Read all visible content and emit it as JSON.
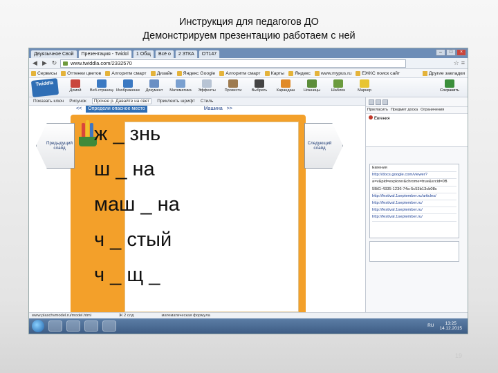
{
  "slide": {
    "title_line1": "Инструкция для педагогов ДО",
    "title_line2": "Демонстрируем презентацию работаем с ней",
    "page_number": "19"
  },
  "browser": {
    "tabs": [
      {
        "label": "Двуязычное Свой",
        "active": false
      },
      {
        "label": "Презентация - Twidol",
        "active": true
      },
      {
        "label": "1 Общ",
        "active": false
      },
      {
        "label": "Всё о",
        "active": false
      },
      {
        "label": "2 ЗТКА",
        "active": false
      },
      {
        "label": "ОТ147",
        "active": false
      }
    ],
    "url": "www.twiddla.com/2332570",
    "bookmarks": [
      "Сервисы",
      "Оттенки цветов",
      "Алгоритм смарт",
      "Дизайн",
      "Яндекс Google",
      "Алгоритм смарт",
      "Карты",
      "Яндекс",
      "www.mypus.ru",
      "ЕЖКС поиск сайт"
    ],
    "bookmarks_right": "Другие закладки"
  },
  "app": {
    "logo": "Twiddla",
    "tools": [
      {
        "label": "Домой",
        "color": "#c9463d"
      },
      {
        "label": "Веб-страница",
        "color": "#3b79c2"
      },
      {
        "label": "Изображение",
        "color": "#3b79c2"
      },
      {
        "label": "Документ",
        "color": "#6a8fc4"
      },
      {
        "label": "Математика",
        "color": "#7aa0d0"
      },
      {
        "label": "Эффекты",
        "color": "#b8c4d4"
      },
      {
        "label": "Провести",
        "color": "#9e7b4f"
      },
      {
        "label": "Выбрать",
        "color": "#444444"
      },
      {
        "label": "Карандаш",
        "color": "#e08a28"
      },
      {
        "label": "Ножницы",
        "color": "#5c8d3a"
      },
      {
        "label": "Шаблон",
        "color": "#6b9b3e"
      },
      {
        "label": "Маркер",
        "color": "#e8c532"
      }
    ],
    "save_label": "Сохранить",
    "subbar": [
      "Показать ключ",
      "Рисунок",
      "Приклеить шрифт",
      "Стиль"
    ],
    "subbar_field": "Прочее p. Давайте на свет",
    "slide_nav": {
      "prev": "<<",
      "current": "Определи опасное место",
      "next_item": "Машина",
      "next": ">>"
    },
    "prev_button": "Предыдущий слайд",
    "next_button": "Следующий слайд"
  },
  "slide_content": {
    "words": [
      "ж _ знь",
      "ш _ на",
      "маш _ на",
      "ч _ стый",
      "ч _ щ _"
    ]
  },
  "right_panel": {
    "head": [
      "Пригласить",
      "Предмет доска",
      "Ограничения"
    ],
    "participant": "Евгения",
    "chat_lines": [
      {
        "text": "Евгения",
        "link": false
      },
      {
        "text": "http://docs.google.com/viewer?",
        "link": true
      },
      {
        "text": "a=v&pid=explorer&chrome=true&srcid=0B",
        "link": false
      },
      {
        "text": "5BiG-4335-1236-74a-5c53b13cb08c",
        "link": false
      },
      {
        "text": "http://festival.1september.ru/articles/",
        "link": true
      },
      {
        "text": "http://festival.1september.ru/",
        "link": true
      },
      {
        "text": "http://festival.1september.ru/",
        "link": true
      },
      {
        "text": "http://festival.1september.ru/",
        "link": true
      }
    ]
  },
  "status": {
    "left": "www.plaschvmodel.ru/model.html",
    "middle": "Ж 2 слд",
    "right": "математическая формула"
  },
  "taskbar": {
    "time": "13:25",
    "date": "14.12.2015",
    "lang": "RU"
  }
}
